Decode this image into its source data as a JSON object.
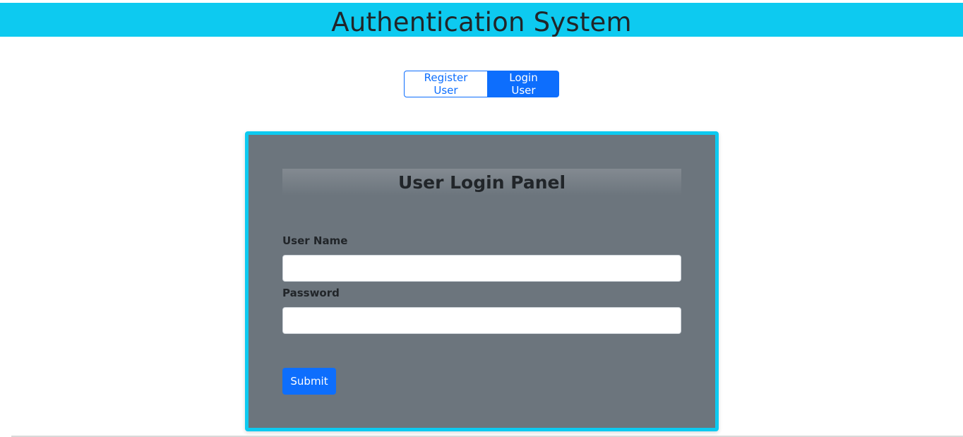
{
  "header": {
    "title": "Authentication System"
  },
  "nav": {
    "register_label": "Register User",
    "login_label": "Login User"
  },
  "login_panel": {
    "title": "User Login Panel",
    "username_label": "User Name",
    "username_value": "",
    "password_label": "Password",
    "password_value": "",
    "submit_label": "Submit"
  },
  "colors": {
    "header_bg": "#0dcaf0",
    "panel_bg": "#6c757d",
    "panel_border": "#0dcaf0",
    "primary": "#0d6efd",
    "text_dark": "#212529"
  }
}
